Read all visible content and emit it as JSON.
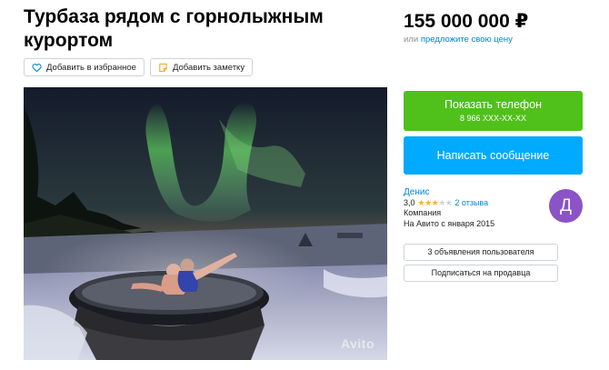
{
  "listing": {
    "title": "Турбаза рядом с горнолыжным курортом",
    "price": "155 000 000 ₽",
    "offer_prefix": "или",
    "offer_link": "предложите свою цену"
  },
  "actions": {
    "favorite_label": "Добавить в избранное",
    "note_label": "Добавить заметку"
  },
  "photo": {
    "watermark": "Avito"
  },
  "contact": {
    "phone_button_label": "Показать телефон",
    "phone_number": "8 966 XXX-XX-XX",
    "message_button_label": "Написать сообщение"
  },
  "seller": {
    "name": "Денис",
    "rating": "3,0",
    "stars_filled": 3,
    "stars_total": 5,
    "reviews": "2 отзыва",
    "type": "Компания",
    "since": "На Авито с января 2015",
    "avatar_letter": "Д",
    "listings_button": "3 объявления пользователя",
    "subscribe_button": "Подписаться на продавца"
  },
  "colors": {
    "phone_button": "#50c01b",
    "message_button": "#00aaff",
    "link": "#0088cc",
    "avatar": "#8b53c5",
    "star": "#ffb021"
  }
}
